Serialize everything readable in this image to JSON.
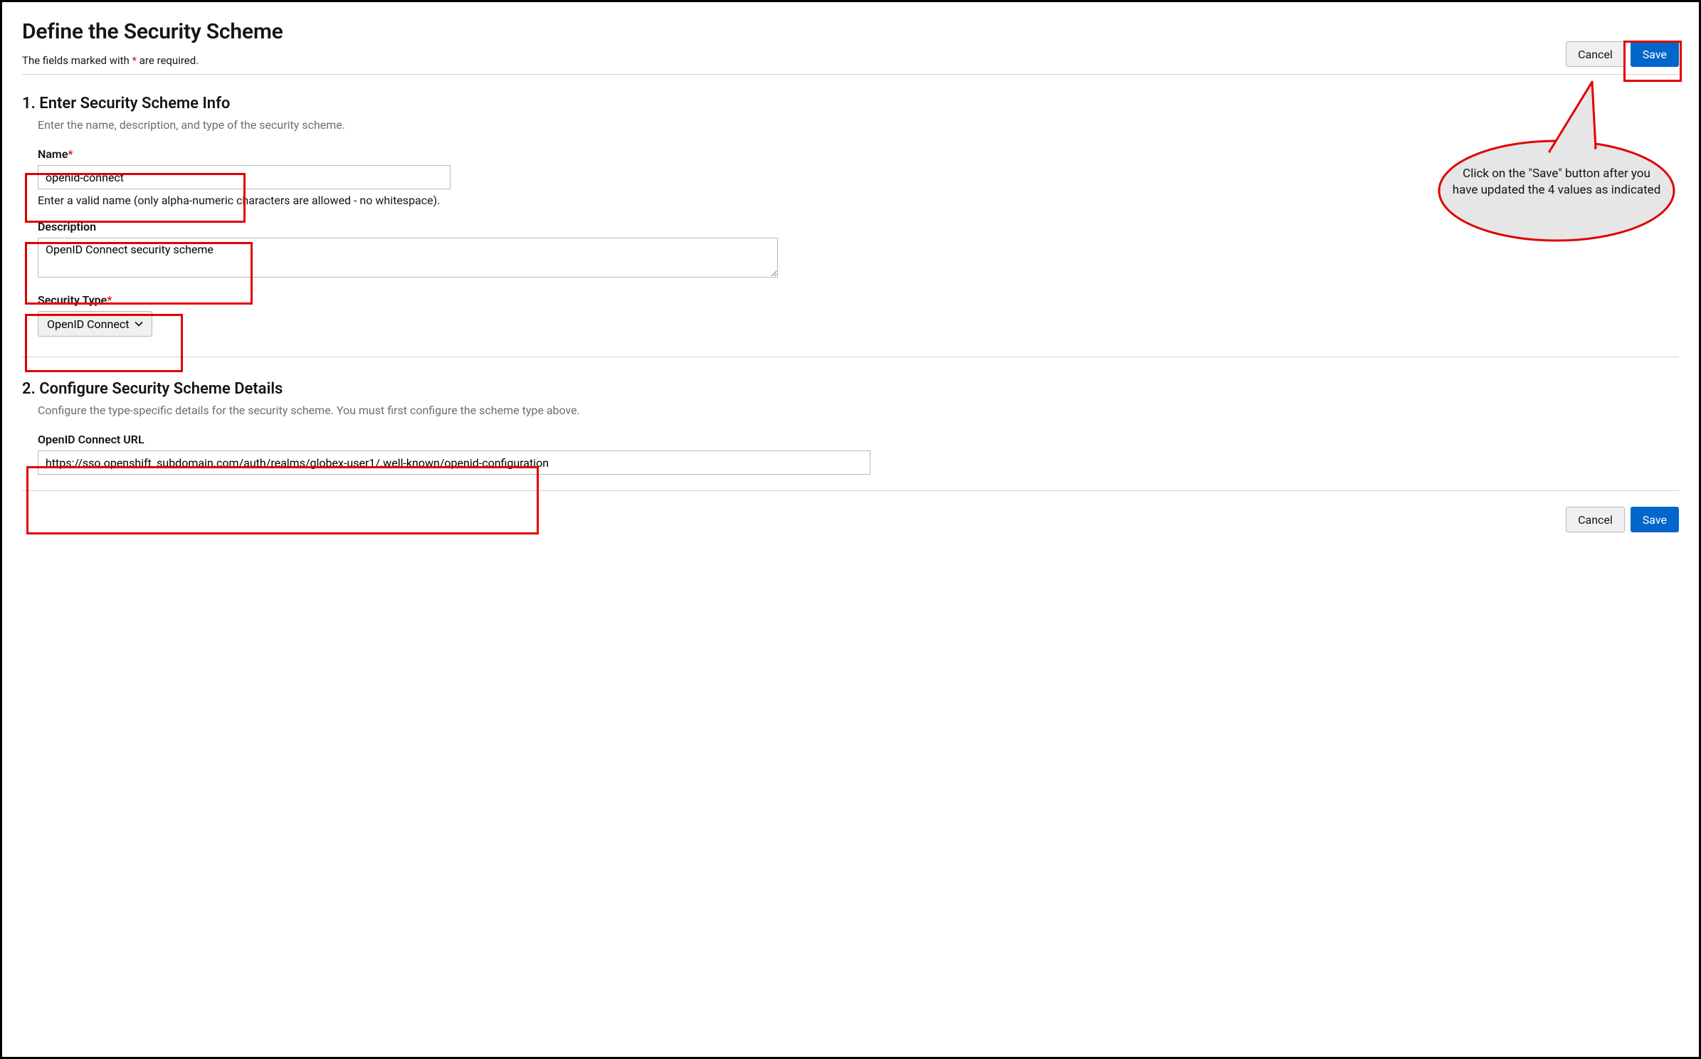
{
  "header": {
    "title": "Define the Security Scheme",
    "required_note_prefix": "The fields marked with ",
    "required_note_marker": "*",
    "required_note_suffix": " are required."
  },
  "buttons": {
    "cancel": "Cancel",
    "save": "Save"
  },
  "section1": {
    "title": "1. Enter Security Scheme Info",
    "desc": "Enter the name, description, and type of the security scheme.",
    "name_label": "Name",
    "name_value": "openid-connect",
    "name_help": "Enter a valid name (only alpha-numeric characters are allowed - no whitespace).",
    "description_label": "Description",
    "description_value": "OpenID Connect security scheme",
    "security_type_label": "Security Type",
    "security_type_value": "OpenID Connect"
  },
  "section2": {
    "title": "2. Configure Security Scheme Details",
    "desc": "Configure the type-specific details for the security scheme. You must first configure the scheme type above.",
    "url_label": "OpenID Connect URL",
    "url_value": "https://sso.openshift_subdomain.com/auth/realms/globex-user1/.well-known/openid-configuration"
  },
  "callout": {
    "text": "Click on the \"Save\" button after you have updated the 4 values as indicated"
  },
  "colors": {
    "primary": "#0066cc",
    "annotation": "#e00000",
    "callout_fill": "#e6e6e6"
  }
}
